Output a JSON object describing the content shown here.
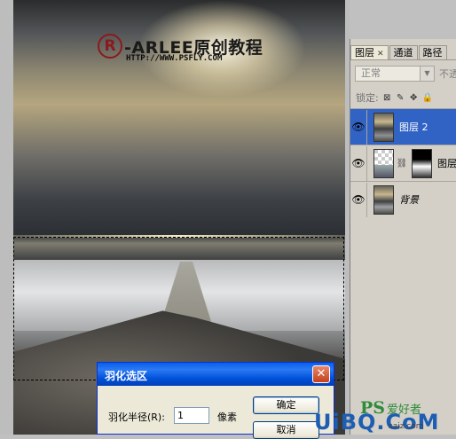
{
  "image": {
    "logo_symbol": "R",
    "logo_text": "-ARLEE原创教程",
    "logo_url": "HTTP://WWW.PSFLY.COM"
  },
  "layers_panel": {
    "tabs": [
      {
        "label": "图层",
        "active": true,
        "closable": true
      },
      {
        "label": "通道",
        "active": false
      },
      {
        "label": "路径",
        "active": false
      }
    ],
    "blend_mode": "正常",
    "opacity_label": "不透",
    "lock_label": "锁定:",
    "layers": [
      {
        "name": "图层 2",
        "selected": true,
        "visible": true
      },
      {
        "name": "图层",
        "selected": false,
        "visible": true,
        "has_mask": true
      },
      {
        "name": "背景",
        "selected": false,
        "visible": true
      }
    ]
  },
  "dialog": {
    "title": "羽化选区",
    "radius_label": "羽化半径(R):",
    "radius_value": "1",
    "unit": "像素",
    "ok_label": "确定",
    "cancel_label": "取消"
  },
  "watermark": {
    "ps": "PS",
    "cn": "爱好者",
    "brand": "UiBQ.CoM",
    "url": "saiz.com"
  },
  "colors": {
    "selection_highlight": "#3163c5",
    "titlebar": "#0a5fe8",
    "watermark_green": "#2f8b3a",
    "watermark_blue": "#1d5db2"
  }
}
